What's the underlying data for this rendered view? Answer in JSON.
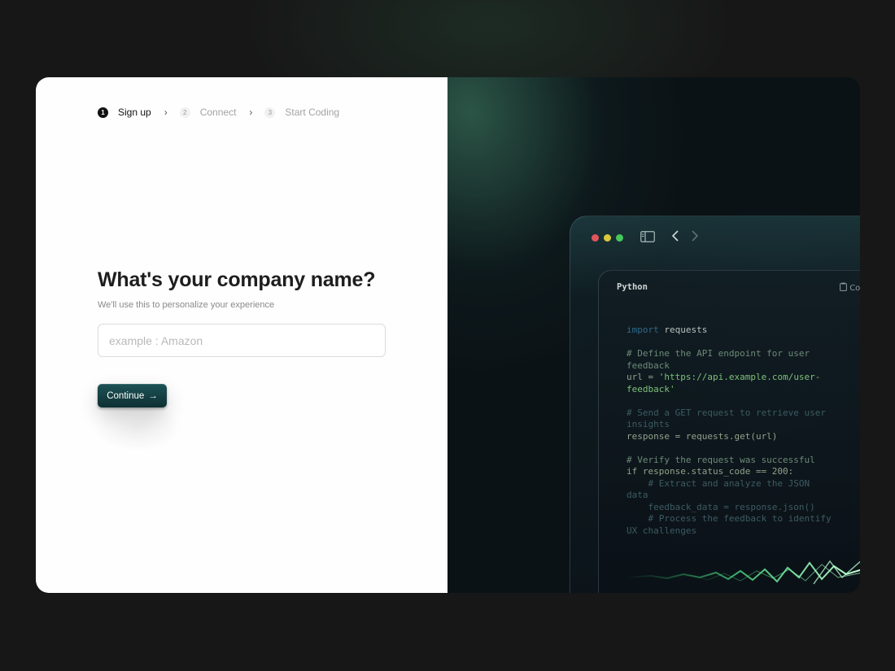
{
  "stepper": {
    "steps": [
      {
        "num": "1",
        "label": "Sign up"
      },
      {
        "num": "2",
        "label": "Connect"
      },
      {
        "num": "3",
        "label": "Start Coding"
      }
    ]
  },
  "form": {
    "title": "What's your company name?",
    "subtitle": "We'll use this to personalize your experience",
    "input_placeholder": "example : Amazon",
    "continue_label": "Continue",
    "continue_icon": "→"
  },
  "code_window": {
    "language": "Python",
    "copy_label": "Co",
    "lines": [
      {
        "cls": "mix",
        "parts": [
          [
            "kw",
            "import"
          ],
          [
            "tx",
            " requests"
          ]
        ]
      },
      {
        "cls": "blank"
      },
      {
        "cls": "cm",
        "text": "# Define the API endpoint for user"
      },
      {
        "cls": "cm",
        "text": "feedback"
      },
      {
        "cls": "mix",
        "parts": [
          [
            "cd",
            "url = "
          ],
          [
            "st",
            "'https://api.example.com/user-"
          ]
        ]
      },
      {
        "cls": "st",
        "text": "feedback'"
      },
      {
        "cls": "blank"
      },
      {
        "cls": "dim",
        "text": "# Send a GET request to retrieve user"
      },
      {
        "cls": "dim",
        "text": "insights"
      },
      {
        "cls": "cd",
        "text": "response = requests.get(url)"
      },
      {
        "cls": "blank"
      },
      {
        "cls": "cm",
        "text": "# Verify the request was successful"
      },
      {
        "cls": "cd",
        "text": "if response.status_code == 200:"
      },
      {
        "cls": "dim",
        "text": "    # Extract and analyze the JSON"
      },
      {
        "cls": "dim",
        "text": "data"
      },
      {
        "cls": "dim",
        "text": "    feedback_data = response.json()"
      },
      {
        "cls": "dim",
        "text": "    # Process the feedback to identify"
      },
      {
        "cls": "dim",
        "text": "UX challenges"
      }
    ]
  },
  "colors": {
    "accent": "#1d5356",
    "dot_red": "#e0545c",
    "dot_yellow": "#d8c83a",
    "dot_green": "#45c85a"
  }
}
